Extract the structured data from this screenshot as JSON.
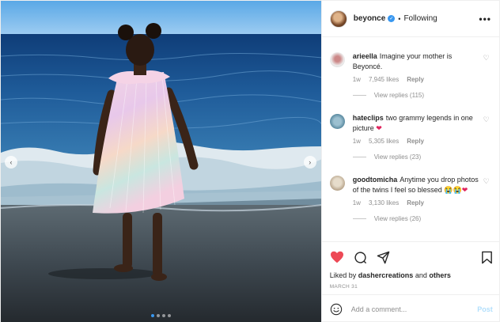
{
  "header": {
    "username": "beyonce",
    "separator": "•",
    "follow_status": "Following",
    "more": "•••"
  },
  "comments": [
    {
      "username": "arieella",
      "text": "Imagine your mother is Beyoncé.",
      "age": "1w",
      "likes": "7,945 likes",
      "reply": "Reply",
      "view_replies": "View replies (115)"
    },
    {
      "username": "hateclips",
      "text": "two grammy legends in one picture",
      "emoji": "❤",
      "age": "1w",
      "likes": "5,305 likes",
      "reply": "Reply",
      "view_replies": "View replies (23)"
    },
    {
      "username": "goodtomicha",
      "text": "Anytime you drop photos of the twins I feel so blessed",
      "emoji": "😭😭❤",
      "age": "1w",
      "likes": "3,130 likes",
      "reply": "Reply",
      "view_replies": "View replies (26)"
    }
  ],
  "actions": {
    "liked_prefix": "Liked by",
    "liked_user": "dashercreations",
    "liked_and": "and",
    "liked_others": "others",
    "date": "MARCH 31"
  },
  "add_comment": {
    "placeholder": "Add a comment...",
    "post_label": "Post"
  },
  "carousel": {
    "slide_count": 4,
    "active_index": 0
  },
  "colors": {
    "like_red": "#ed4956",
    "verified_blue": "#3897f0",
    "post_disabled": "#b2dffc"
  }
}
